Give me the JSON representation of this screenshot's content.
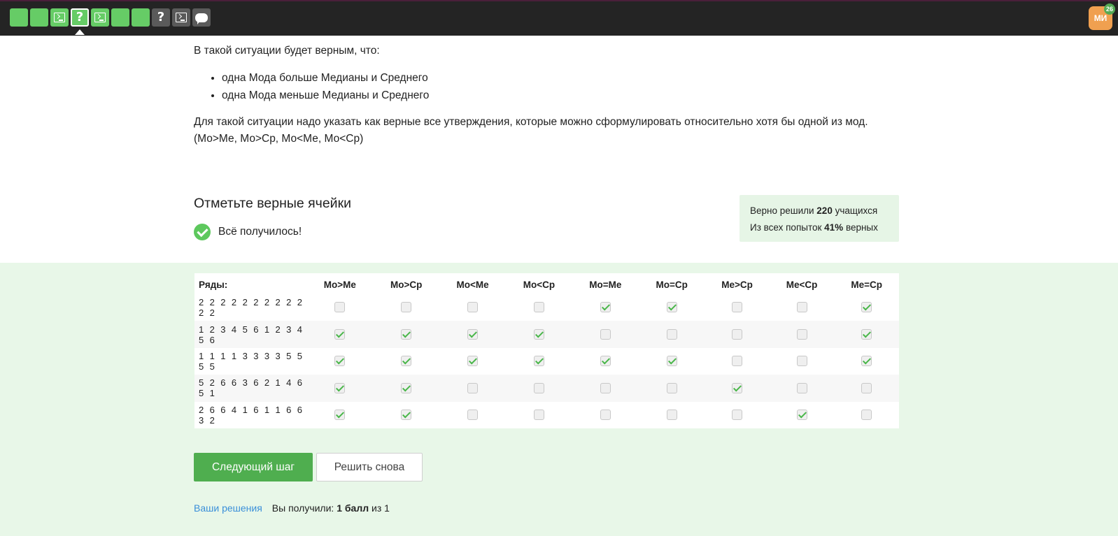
{
  "topbar": {
    "steps": [
      {
        "kind": "plain",
        "color": "green"
      },
      {
        "kind": "plain",
        "color": "green"
      },
      {
        "kind": "terminal",
        "color": "green"
      },
      {
        "kind": "question",
        "color": "green",
        "current": true
      },
      {
        "kind": "terminal",
        "color": "green"
      },
      {
        "kind": "plain",
        "color": "green"
      },
      {
        "kind": "plain",
        "color": "green"
      },
      {
        "kind": "question",
        "color": "gray"
      },
      {
        "kind": "terminal",
        "color": "gray"
      },
      {
        "kind": "chat",
        "color": "gray"
      }
    ],
    "avatar_initials": "МИ",
    "avatar_badge": "26"
  },
  "intro": {
    "line1": "В такой ситуации будет верным, что:",
    "bullets": [
      "одна Мода больше Медианы и Среднего",
      "одна Мода меньше Медианы и Среднего"
    ],
    "para": "Для такой ситуации надо указать как верные все утверждения, которые можно сформулировать относительно хотя бы одной из мод.",
    "para2": "(Мо>Ме, Мо>Ср, Мо<Ме, Мо<Ср)"
  },
  "task": {
    "title": "Отметьте верные ячейки",
    "success_text": "Всё получилось!"
  },
  "stats": {
    "line1_pre": "Верно решили ",
    "line1_num": "220",
    "line1_post": " учащихся",
    "line2_pre": "Из всех попыток ",
    "line2_num": "41%",
    "line2_post": " верных"
  },
  "grid": {
    "corner": "Ряды:",
    "columns": [
      "Мо>Ме",
      "Мо>Ср",
      "Мо<Ме",
      "Мо<Ср",
      "Мо=Ме",
      "Мо=Ср",
      "Ме>Ср",
      "Ме<Ср",
      "Ме=Ср"
    ],
    "rows": [
      {
        "label": "2 2 2 2 2 2 2 2 2 2 2 2",
        "checks": [
          false,
          false,
          false,
          false,
          true,
          true,
          false,
          false,
          true
        ]
      },
      {
        "label": "1 2 3 4 5 6 1 2 3 4 5 6",
        "checks": [
          true,
          true,
          true,
          true,
          false,
          false,
          false,
          false,
          true
        ]
      },
      {
        "label": "1 1 1 1 3 3 3 3 5 5 5 5",
        "checks": [
          true,
          true,
          true,
          true,
          true,
          true,
          false,
          false,
          true
        ]
      },
      {
        "label": "5 2 6 6 3 6 2 1 4 6 5 1",
        "checks": [
          true,
          true,
          false,
          false,
          false,
          false,
          true,
          false,
          false
        ]
      },
      {
        "label": "2 6 6 4 1 6 1 1 6 6 3 2",
        "checks": [
          true,
          true,
          false,
          false,
          false,
          false,
          false,
          true,
          false
        ]
      }
    ]
  },
  "buttons": {
    "next": "Следующий шаг",
    "retry": "Решить снова"
  },
  "footer": {
    "solutions_link": "Ваши решения",
    "score_pre": "Вы получили: ",
    "score_bold": "1 балл",
    "score_post": " из 1"
  }
}
